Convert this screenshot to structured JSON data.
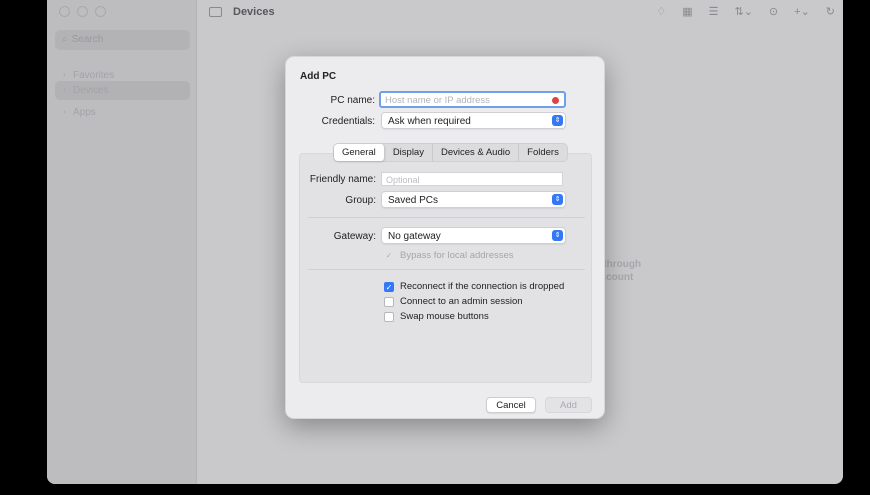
{
  "window": {
    "title": "Devices"
  },
  "sidebar": {
    "search_placeholder": "Search",
    "items": [
      {
        "label": "Favorites",
        "selected": false
      },
      {
        "label": "Devices",
        "selected": true
      },
      {
        "label": "Apps",
        "selected": false
      }
    ]
  },
  "toolbar": {
    "icons": [
      "bell-icon",
      "grid-view-icon",
      "list-view-icon",
      "sort-icon",
      "settings-icon",
      "add-icon",
      "refresh-icon"
    ]
  },
  "background": {
    "empty_text_line1": "s through",
    "empty_text_line2": "account"
  },
  "dialog": {
    "title": "Add PC",
    "pc_name_label": "PC name:",
    "pc_name_value": "",
    "pc_name_placeholder": "Host name or IP address",
    "credentials_label": "Credentials:",
    "credentials_value": "Ask when required",
    "tabs": [
      {
        "label": "General",
        "active": true
      },
      {
        "label": "Display",
        "active": false
      },
      {
        "label": "Devices & Audio",
        "active": false
      },
      {
        "label": "Folders",
        "active": false
      }
    ],
    "friendly_name_label": "Friendly name:",
    "friendly_name_placeholder": "Optional",
    "group_label": "Group:",
    "group_value": "Saved PCs",
    "gateway_label": "Gateway:",
    "gateway_value": "No gateway",
    "bypass_label": "Bypass for local addresses",
    "reconnect_label": "Reconnect if the connection is dropped",
    "reconnect_checked": true,
    "admin_label": "Connect to an admin session",
    "admin_checked": false,
    "swap_label": "Swap mouse buttons",
    "swap_checked": false,
    "cancel_label": "Cancel",
    "add_label": "Add"
  },
  "colors": {
    "accent": "#3478f6",
    "error": "#e0443e"
  }
}
